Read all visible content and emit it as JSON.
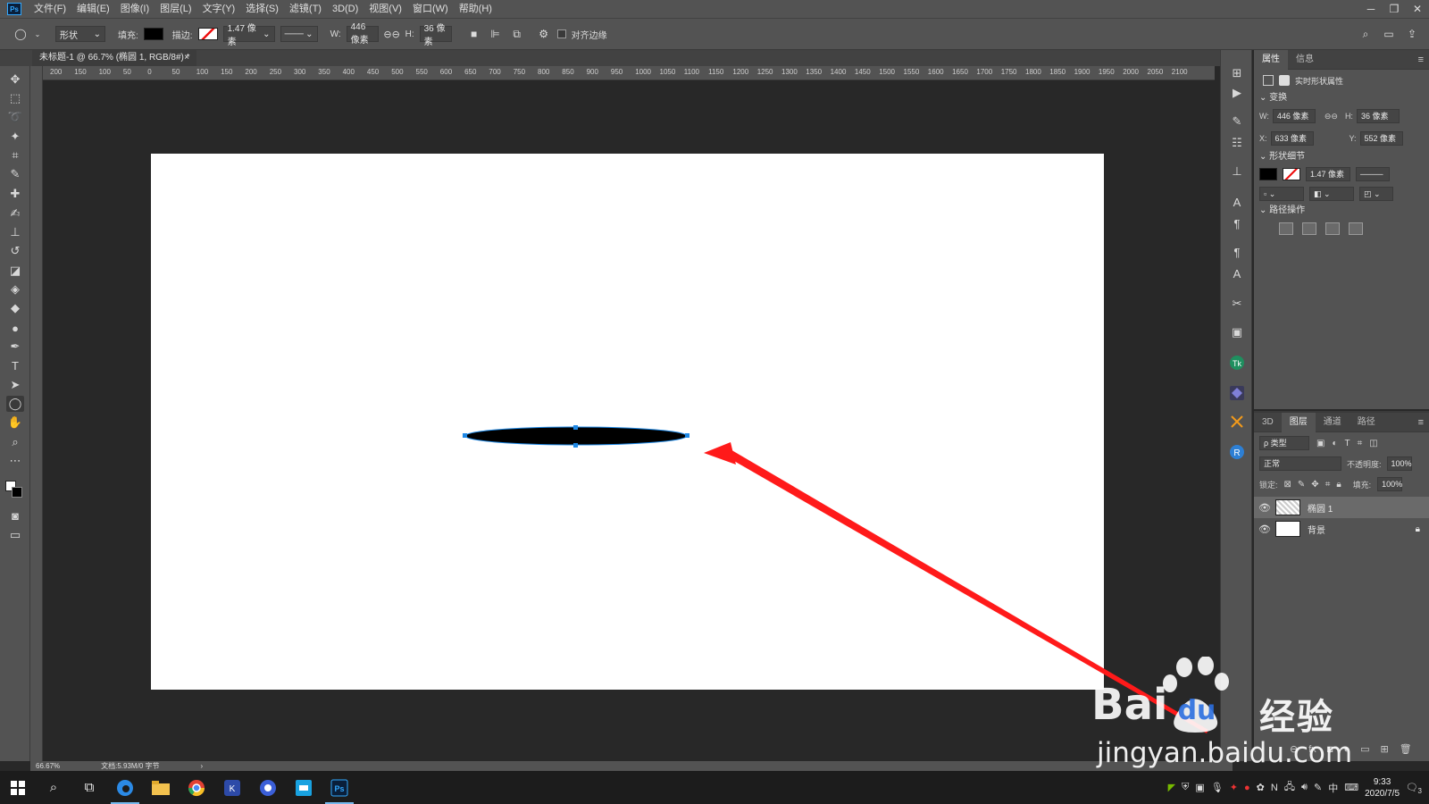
{
  "app": {
    "logo": "Ps",
    "menu": [
      "文件(F)",
      "编辑(E)",
      "图像(I)",
      "图层(L)",
      "文字(Y)",
      "选择(S)",
      "滤镜(T)",
      "3D(D)",
      "视图(V)",
      "窗口(W)",
      "帮助(H)"
    ],
    "window_controls": [
      "─",
      "❐",
      "✕"
    ]
  },
  "options": {
    "tool_mode": "形状",
    "fill_label": "填充:",
    "stroke_label": "描边:",
    "stroke_width": "1.47 像素",
    "width_label": "W:",
    "width_value": "446 像素",
    "height_label": "H:",
    "height_value": "36 像素",
    "align_edges_label": "对齐边缘"
  },
  "document": {
    "tab_title": "未标题-1 @ 66.7% (椭圆 1, RGB/8#) *",
    "tab_close": "×",
    "zoom": "66.67%",
    "doc_info": "文档:5.93M/0 字节"
  },
  "ruler": {
    "h_labels": [
      "200",
      "150",
      "100",
      "50",
      "0",
      "50",
      "100",
      "150",
      "200",
      "250",
      "300",
      "350",
      "400",
      "450",
      "500",
      "550",
      "600",
      "650",
      "700",
      "750",
      "800",
      "850",
      "900",
      "950",
      "1000",
      "1050",
      "1100",
      "1150",
      "1200",
      "1250",
      "1300",
      "1350",
      "1400",
      "1450",
      "1500",
      "1550",
      "1600",
      "1650",
      "1700",
      "1750",
      "1800",
      "1850",
      "1900",
      "1950",
      "2000",
      "2050",
      "2100"
    ]
  },
  "properties": {
    "tabs": [
      "属性",
      "信息"
    ],
    "title": "实时形状属性",
    "transform_section": "变换",
    "w_label": "W:",
    "w_value": "446 像素",
    "h_label": "H:",
    "h_value": "36 像素",
    "x_label": "X:",
    "x_value": "633 像素",
    "y_label": "Y:",
    "y_value": "552 像素",
    "shape_section": "形状细节",
    "stroke_width": "1.47 像素",
    "path_section": "路径操作"
  },
  "layers": {
    "tabs": [
      "3D",
      "图层",
      "通道",
      "路径"
    ],
    "filter_label": "ρ 类型",
    "blend_mode": "正常",
    "opacity_label": "不透明度:",
    "opacity_value": "100%",
    "lock_label": "锁定:",
    "fill_label": "填充:",
    "fill_value": "100%",
    "items": [
      {
        "name": "椭圆 1"
      },
      {
        "name": "背景"
      }
    ]
  },
  "taskbar": {
    "ime": "中",
    "time": "9:33",
    "date": "2020/7/5",
    "notifications": "3"
  },
  "watermark": {
    "logo_text": "Bai",
    "logo_suffix": "du",
    "logo_cn": "经验",
    "url": "jingyan.baidu.com"
  },
  "colors": {
    "annotation_arrow": "#ff1a1a",
    "ellipse_fill": "#000000",
    "anchor": "#1e88e5"
  }
}
